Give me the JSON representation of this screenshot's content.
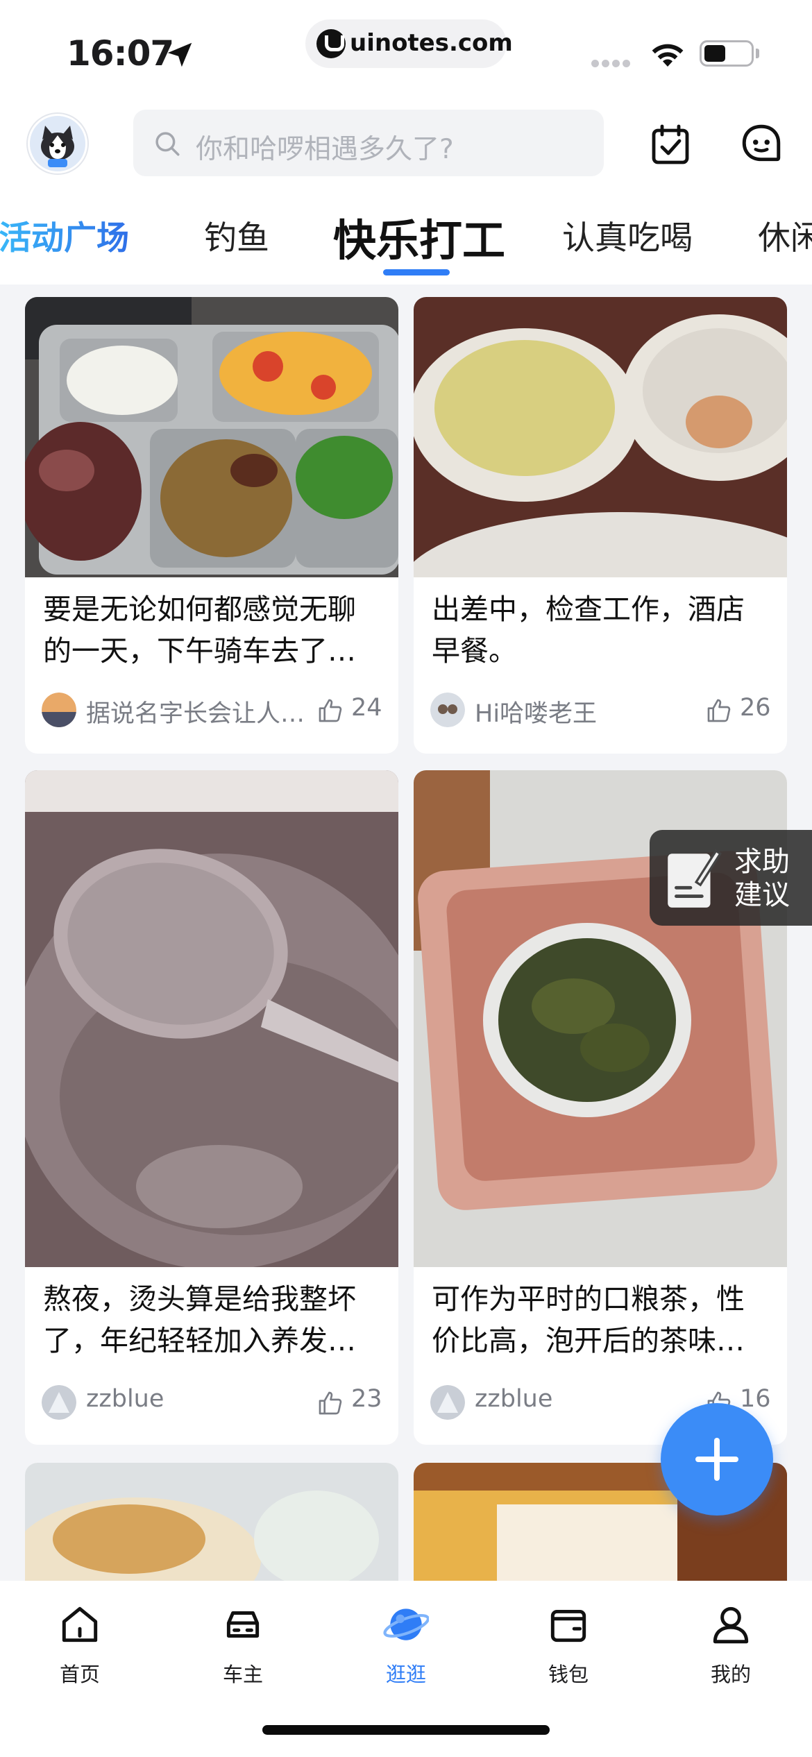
{
  "status_bar": {
    "time": "16:07",
    "url": "uinotes.com"
  },
  "header": {
    "search_placeholder": "你和哈啰相遇多久了?"
  },
  "tabs": [
    {
      "label": "活动广场"
    },
    {
      "label": "钓鱼"
    },
    {
      "label": "快乐打工"
    },
    {
      "label": "认真吃喝"
    },
    {
      "label": "休闲"
    }
  ],
  "active_tab": "快乐打工",
  "feed": [
    {
      "title_line1": "要是无论如何都感觉无聊",
      "title_line2": "的一天，下午骑车去了…",
      "author": "据说名字长会让人…",
      "likes": "24"
    },
    {
      "title_line1": "出差中，检查工作，酒店",
      "title_line2": "早餐。",
      "author": "Hi哈喽老王",
      "likes": "26"
    },
    {
      "title_line1": "熬夜，烫头算是给我整坏",
      "title_line2": "了，年纪轻轻加入养发…",
      "author": "zzblue",
      "likes": "23"
    },
    {
      "title_line1": "可作为平时的口粮茶，性",
      "title_line2": "价比高，泡开后的茶味…",
      "author": "zzblue",
      "likes": "16"
    }
  ],
  "help_widget": {
    "line1": "求助",
    "line2": "建议"
  },
  "bottom_nav": [
    {
      "label": "首页",
      "icon": "home-icon"
    },
    {
      "label": "车主",
      "icon": "car-icon"
    },
    {
      "label": "逛逛",
      "icon": "planet-icon"
    },
    {
      "label": "钱包",
      "icon": "wallet-icon"
    },
    {
      "label": "我的",
      "icon": "profile-icon"
    }
  ],
  "active_nav": "逛逛",
  "colors": {
    "accent": "#2f7df6",
    "fab": "#3b8cf7",
    "background": "#f3f4f7"
  }
}
